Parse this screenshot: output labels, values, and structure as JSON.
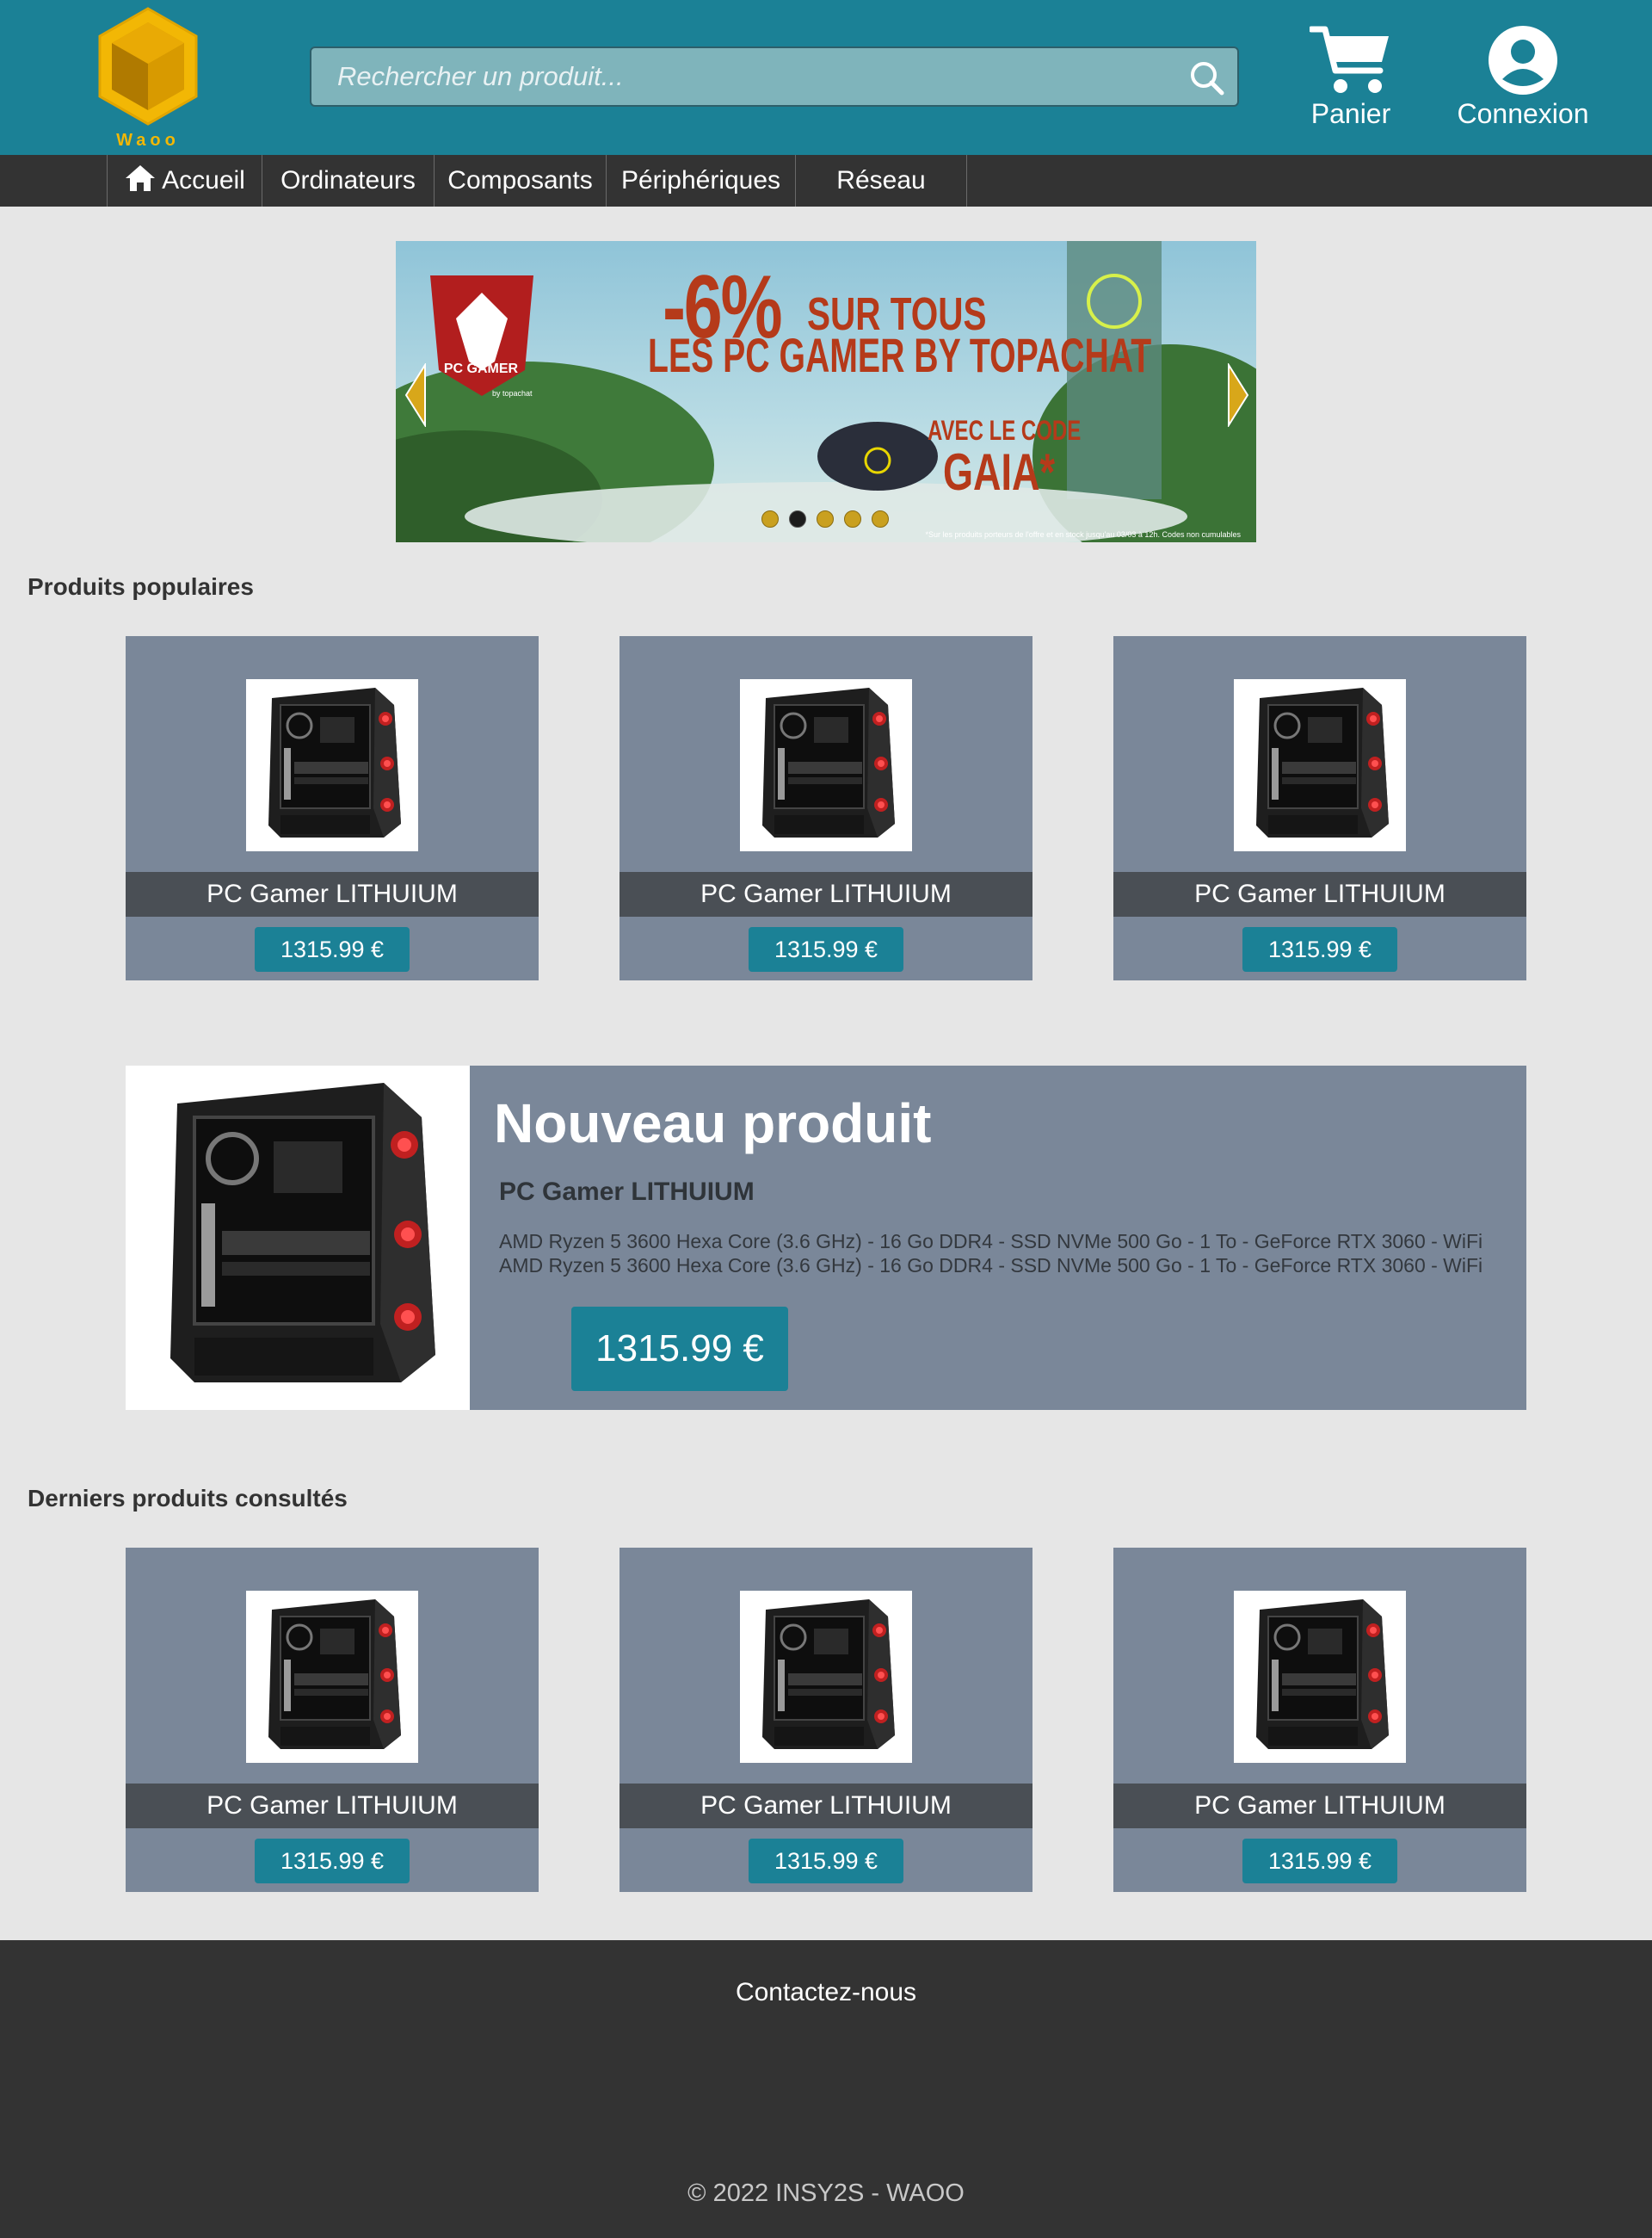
{
  "header": {
    "logo_text": "Waoo",
    "search_placeholder": "Rechercher un produit...",
    "cart_label": "Panier",
    "login_label": "Connexion"
  },
  "nav": {
    "items": [
      {
        "label": "Accueil",
        "icon": "home-icon"
      },
      {
        "label": "Ordinateurs"
      },
      {
        "label": "Composants"
      },
      {
        "label": "Périphériques"
      },
      {
        "label": "Réseau"
      }
    ]
  },
  "banner": {
    "line1_big": "-6%",
    "line1_small": "SUR TOUS",
    "line2": "LES PC GAMER BY TOPACHAT",
    "line3": "AVEC LE CODE",
    "line4": "GAIA*",
    "badge": "PC GAMER",
    "badge_sub": "by topachat",
    "note": "*Sur les produits porteurs de l'offre et en stock jusqu'au 03/03 à 12h. Codes non cumulables",
    "slide_count": 5,
    "active_slide": 2
  },
  "popular": {
    "title": "Produits populaires",
    "products": [
      {
        "name": "PC Gamer LITHUIUM",
        "price": "1315.99 €"
      },
      {
        "name": "PC Gamer LITHUIUM",
        "price": "1315.99 €"
      },
      {
        "name": "PC Gamer LITHUIUM",
        "price": "1315.99 €"
      }
    ]
  },
  "featured": {
    "title": "Nouveau produit",
    "name": "PC Gamer LITHUIUM",
    "desc_line1": "AMD Ryzen 5 3600 Hexa Core (3.6 GHz) - 16 Go DDR4 - SSD NVMe 500 Go - 1 To - GeForce RTX 3060 - WiFi",
    "desc_line2": "AMD Ryzen 5 3600 Hexa Core (3.6 GHz) - 16 Go DDR4 - SSD NVMe 500 Go - 1 To - GeForce RTX 3060 - WiFi",
    "price": "1315.99 €"
  },
  "recent": {
    "title": "Derniers produits consultés",
    "products": [
      {
        "name": "PC Gamer LITHUIUM",
        "price": "1315.99 €"
      },
      {
        "name": "PC Gamer LITHUIUM",
        "price": "1315.99 €"
      },
      {
        "name": "PC Gamer LITHUIUM",
        "price": "1315.99 €"
      }
    ]
  },
  "footer": {
    "contact": "Contactez-nous",
    "copyright": "© 2022 INSY2S - WAOO"
  },
  "colors": {
    "header": "#1b8196",
    "nav": "#333333",
    "card": "#7a8799",
    "accent": "#1b8196",
    "logo": "#f2b705"
  }
}
